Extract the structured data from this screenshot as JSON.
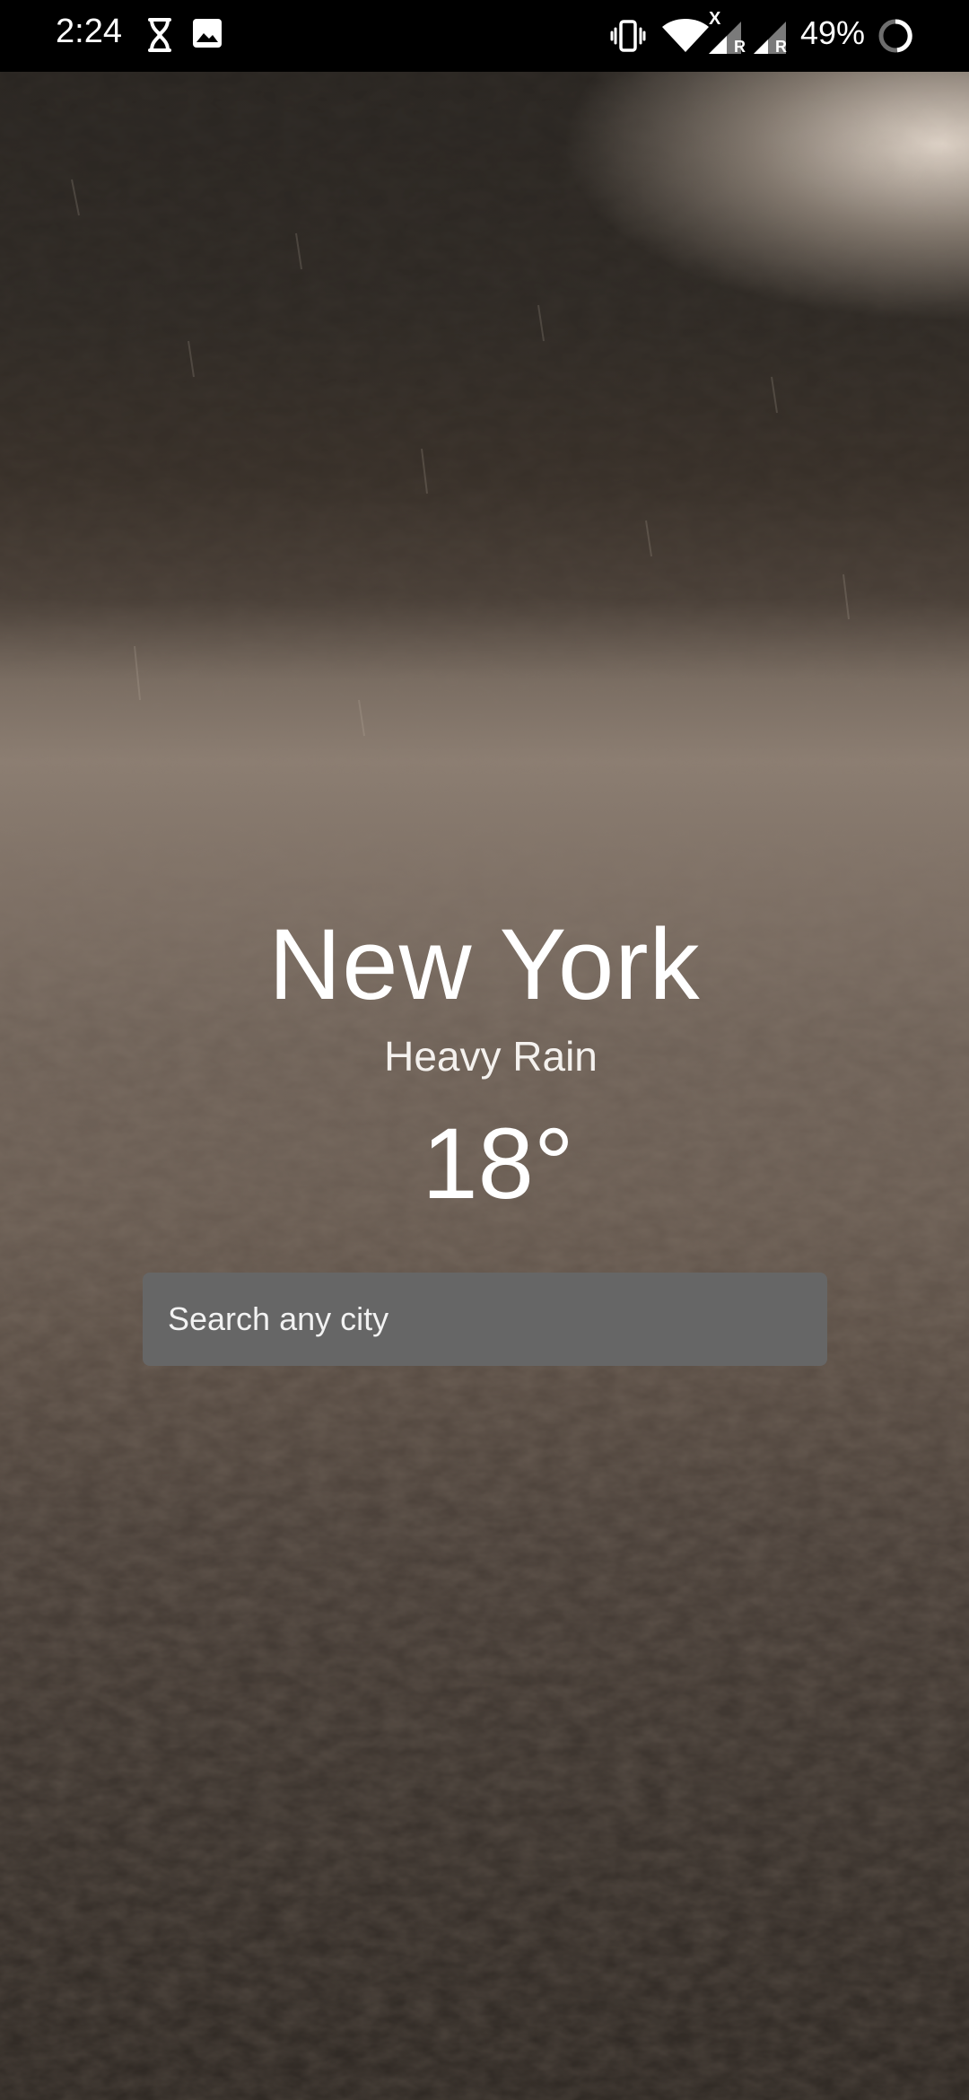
{
  "status_bar": {
    "time": "2:24",
    "battery_text": "49%",
    "icons": [
      "hourglass-icon",
      "image-icon",
      "vibrate-icon",
      "wifi-icon",
      "signal-icon",
      "signal-icon",
      "battery-icon"
    ],
    "signal_badges": [
      "X",
      "R",
      "R"
    ]
  },
  "weather": {
    "city": "New York",
    "condition": "Heavy Rain",
    "temperature": "18°"
  },
  "search": {
    "placeholder": "Search any city"
  },
  "colors": {
    "status_bar_bg": "#000000",
    "search_bg": "#666666",
    "text": "#ffffff"
  }
}
